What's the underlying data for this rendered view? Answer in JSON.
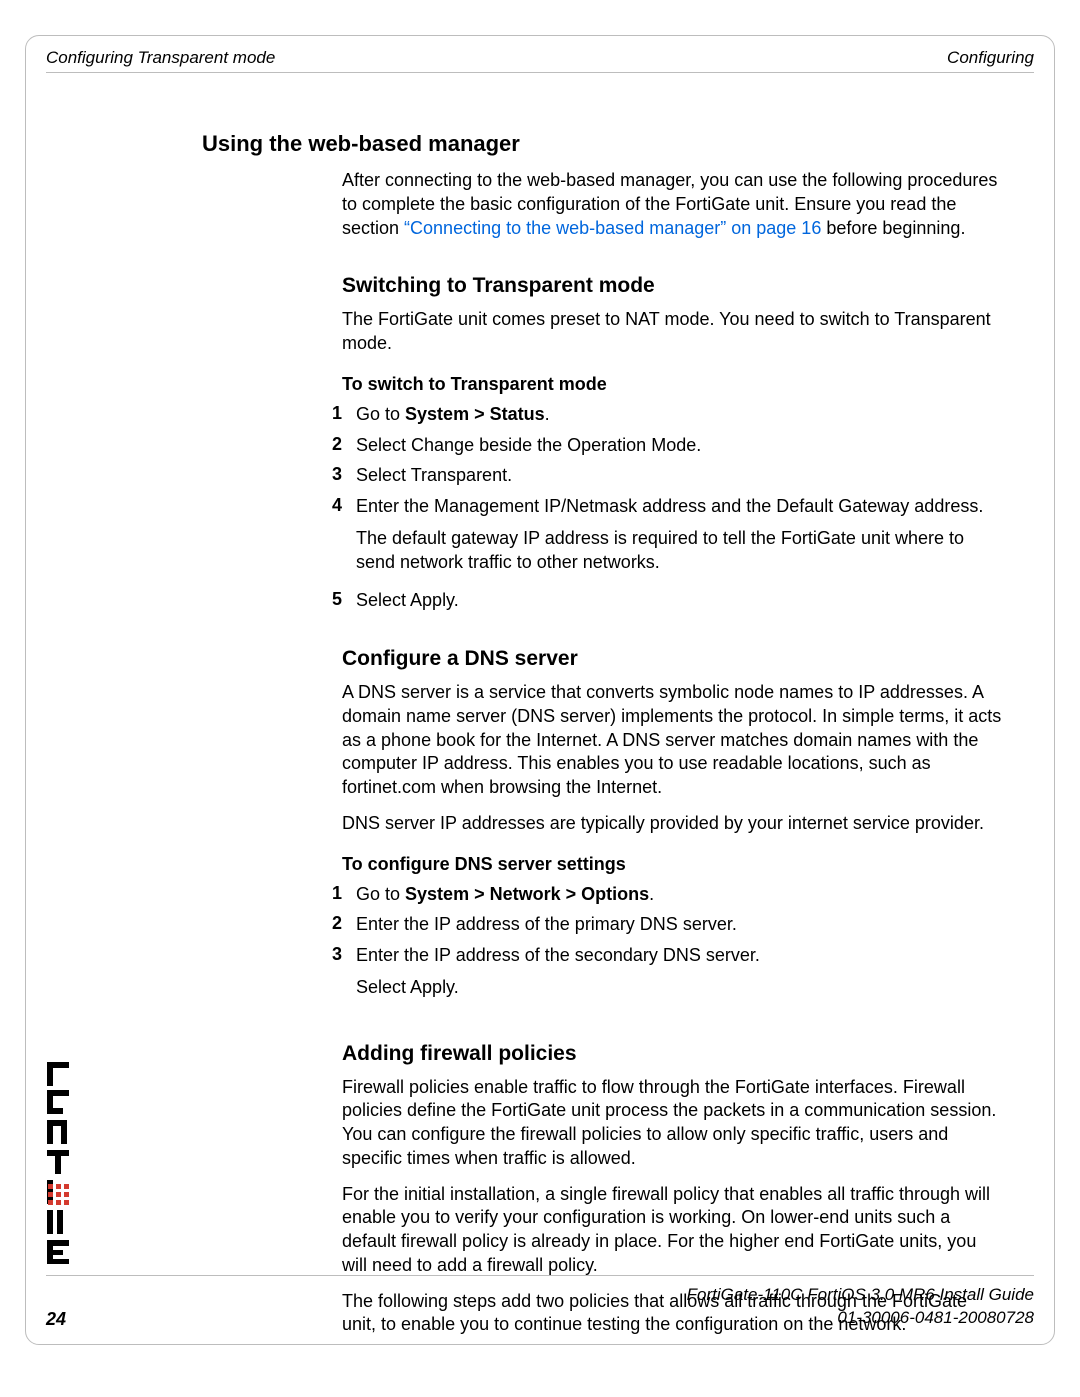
{
  "header": {
    "left": "Configuring Transparent mode",
    "right": "Configuring"
  },
  "sections": {
    "using_web": {
      "title": "Using the web-based manager",
      "p1_a": "After connecting to the web-based manager, you can use the following procedures to complete the basic configuration of the FortiGate unit. Ensure you read the section ",
      "p1_link": "“Connecting to the web-based manager” on page 16",
      "p1_b": " before beginning."
    },
    "switching": {
      "title": "Switching to Transparent mode",
      "p1": "The FortiGate unit comes preset to NAT mode. You need to switch to Transparent mode.",
      "task_title": "To switch to Transparent mode",
      "steps": [
        {
          "n": "1",
          "prefix": "Go to ",
          "bold": "System > Status",
          "suffix": "."
        },
        {
          "n": "2",
          "text": "Select Change beside the Operation Mode."
        },
        {
          "n": "3",
          "text": "Select Transparent."
        },
        {
          "n": "4",
          "text": "Enter the Management IP/Netmask address and the Default Gateway address.",
          "followup": "The default gateway IP address is required to tell the FortiGate unit where to send network traffic to other networks."
        },
        {
          "n": "5",
          "text": "Select Apply."
        }
      ]
    },
    "dns": {
      "title": "Configure a DNS server",
      "p1": "A DNS server is a service that converts symbolic node names to IP addresses. A domain name server (DNS server) implements the protocol. In simple terms, it acts as a phone book for the Internet. A DNS server matches domain names with the computer IP address. This enables you to use readable locations, such as fortinet.com when browsing the Internet.",
      "p2": "DNS server IP addresses are typically provided by your internet service provider.",
      "task_title": "To configure DNS server settings",
      "steps": [
        {
          "n": "1",
          "prefix": "Go to ",
          "bold": "System > Network > Options",
          "suffix": "."
        },
        {
          "n": "2",
          "text": "Enter the IP address of the primary DNS server."
        },
        {
          "n": "3",
          "text": "Enter the IP address of the secondary DNS server.",
          "followup": "Select Apply."
        }
      ]
    },
    "firewall": {
      "title": "Adding firewall policies",
      "p1": "Firewall policies enable traffic to flow through the FortiGate interfaces. Firewall policies define the FortiGate unit process the packets in a communication session. You can configure the firewall policies to allow only specific traffic, users and specific times when traffic is allowed.",
      "p2": "For the initial installation, a single firewall policy that enables all traffic through will enable you to verify your configuration is working. On lower-end units such a default firewall policy is already in place. For the higher end FortiGate units, you will need to add a firewall policy.",
      "p3": "The following steps add two policies that allows all traffic through the FortiGate unit, to enable you to continue testing the configuration on the network."
    }
  },
  "footer": {
    "page": "24",
    "line1": "FortiGate-110C FortiOS 3.0 MR6 Install Guide",
    "line2": "01-30006-0481-20080728"
  }
}
